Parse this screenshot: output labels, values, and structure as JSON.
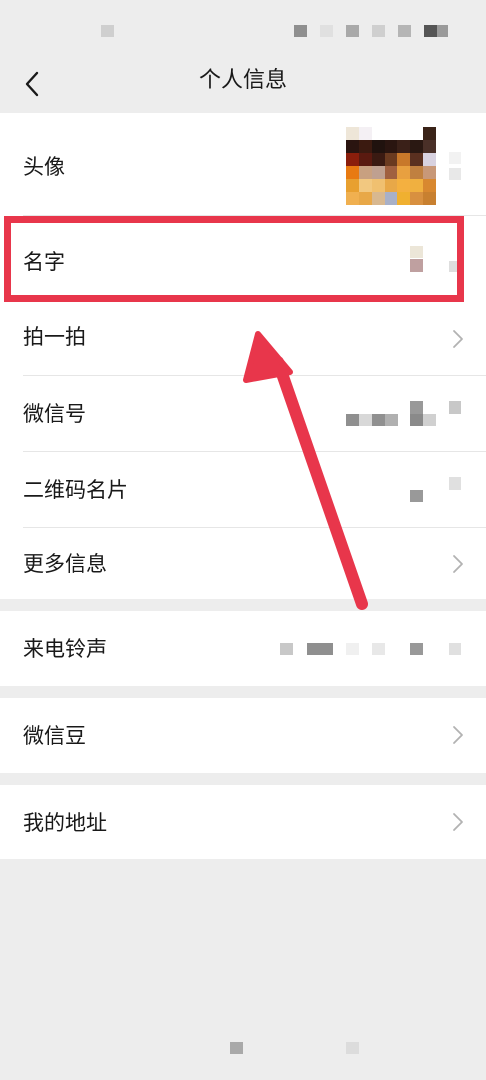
{
  "nav": {
    "title": "个人信息",
    "back_icon": "chevron-left-icon"
  },
  "profile_group": {
    "rows": [
      {
        "key": "avatar",
        "label": "头像"
      },
      {
        "key": "name",
        "label": "名字"
      },
      {
        "key": "pat",
        "label": "拍一拍",
        "icon": "chevron-right-icon"
      },
      {
        "key": "wechat_id",
        "label": "微信号"
      },
      {
        "key": "qr_code",
        "label": "二维码名片"
      },
      {
        "key": "more_info",
        "label": "更多信息",
        "icon": "chevron-right-icon"
      }
    ]
  },
  "ringtone_group": {
    "label": "来电铃声"
  },
  "beans_group": {
    "label": "微信豆",
    "icon": "chevron-right-icon"
  },
  "address_group": {
    "label": "我的地址",
    "icon": "chevron-right-icon"
  },
  "annotation": {
    "highlight_color": "#e8364b",
    "highlighted_row": "名字"
  }
}
